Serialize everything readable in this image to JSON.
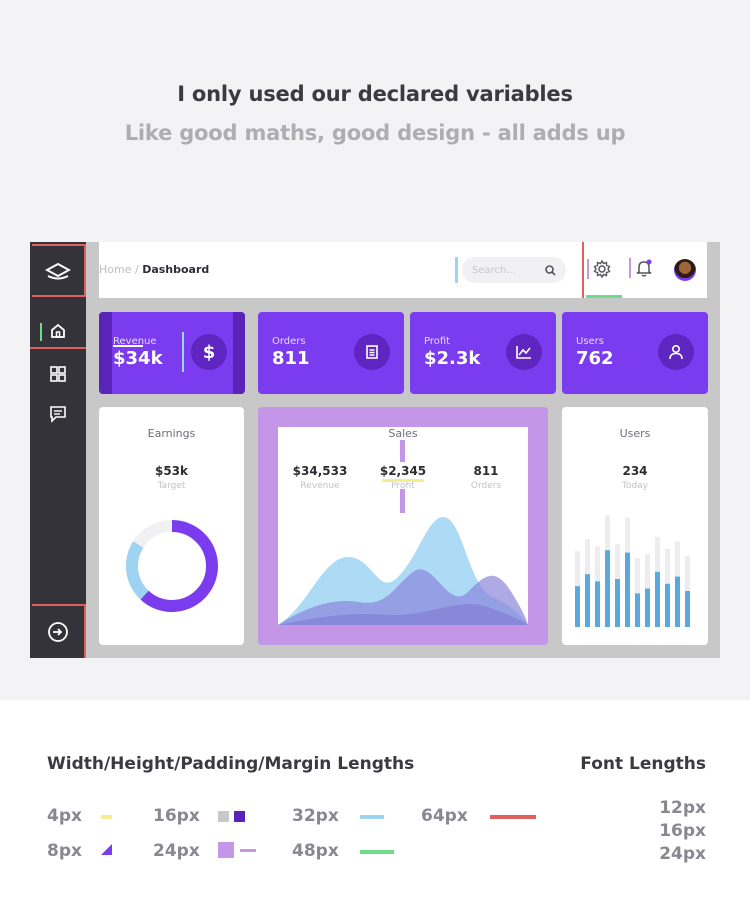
{
  "headline": "I only used our declared variables",
  "subline": "Like good maths, good design - all adds up",
  "header": {
    "breadcrumb_home": "Home",
    "breadcrumb_sep": " / ",
    "breadcrumb_current": "Dashboard",
    "search_placeholder": "Search..."
  },
  "icons": [
    "logo-icon",
    "home-icon",
    "grid-icon",
    "chat-icon",
    "logout-icon",
    "search-icon",
    "gear-icon",
    "bell-icon",
    "dollar-icon",
    "receipt-icon",
    "chart-icon",
    "user-icon"
  ],
  "stat_cards": [
    {
      "label": "Revenue",
      "value": "$34k",
      "icon": "$"
    },
    {
      "label": "Orders",
      "value": "811"
    },
    {
      "label": "Profit",
      "value": "$2.3k"
    },
    {
      "label": "Users",
      "value": "762"
    }
  ],
  "earnings": {
    "title": "Earnings",
    "value": "$53k",
    "sub": "Target",
    "progress": 0.62
  },
  "sales": {
    "title": "Sales",
    "stats": [
      {
        "value": "$34,533",
        "sub": "Revenue"
      },
      {
        "value": "$2,345",
        "sub": "Profit"
      },
      {
        "value": "811",
        "sub": "Orders"
      }
    ]
  },
  "users": {
    "title": "Users",
    "value": "234",
    "sub": "Today",
    "bars": [
      0.34,
      0.44,
      0.38,
      0.64,
      0.4,
      0.62,
      0.28,
      0.32,
      0.46,
      0.36,
      0.42,
      0.3
    ]
  },
  "colors": {
    "accent": "#7b3cf0",
    "red": "#e0605e",
    "green": "#6edc8a",
    "blue": "#9fd3f2",
    "lavender": "#c396e8",
    "yellow": "#f6ee8c"
  },
  "legend": {
    "title": "Width/Height/Padding/Margin Lengths",
    "font_title": "Font Lengths",
    "items": [
      "4px",
      "16px",
      "32px",
      "64px",
      "8px",
      "24px",
      "48px"
    ],
    "font_sizes": [
      "12px",
      "16px",
      "24px"
    ]
  }
}
